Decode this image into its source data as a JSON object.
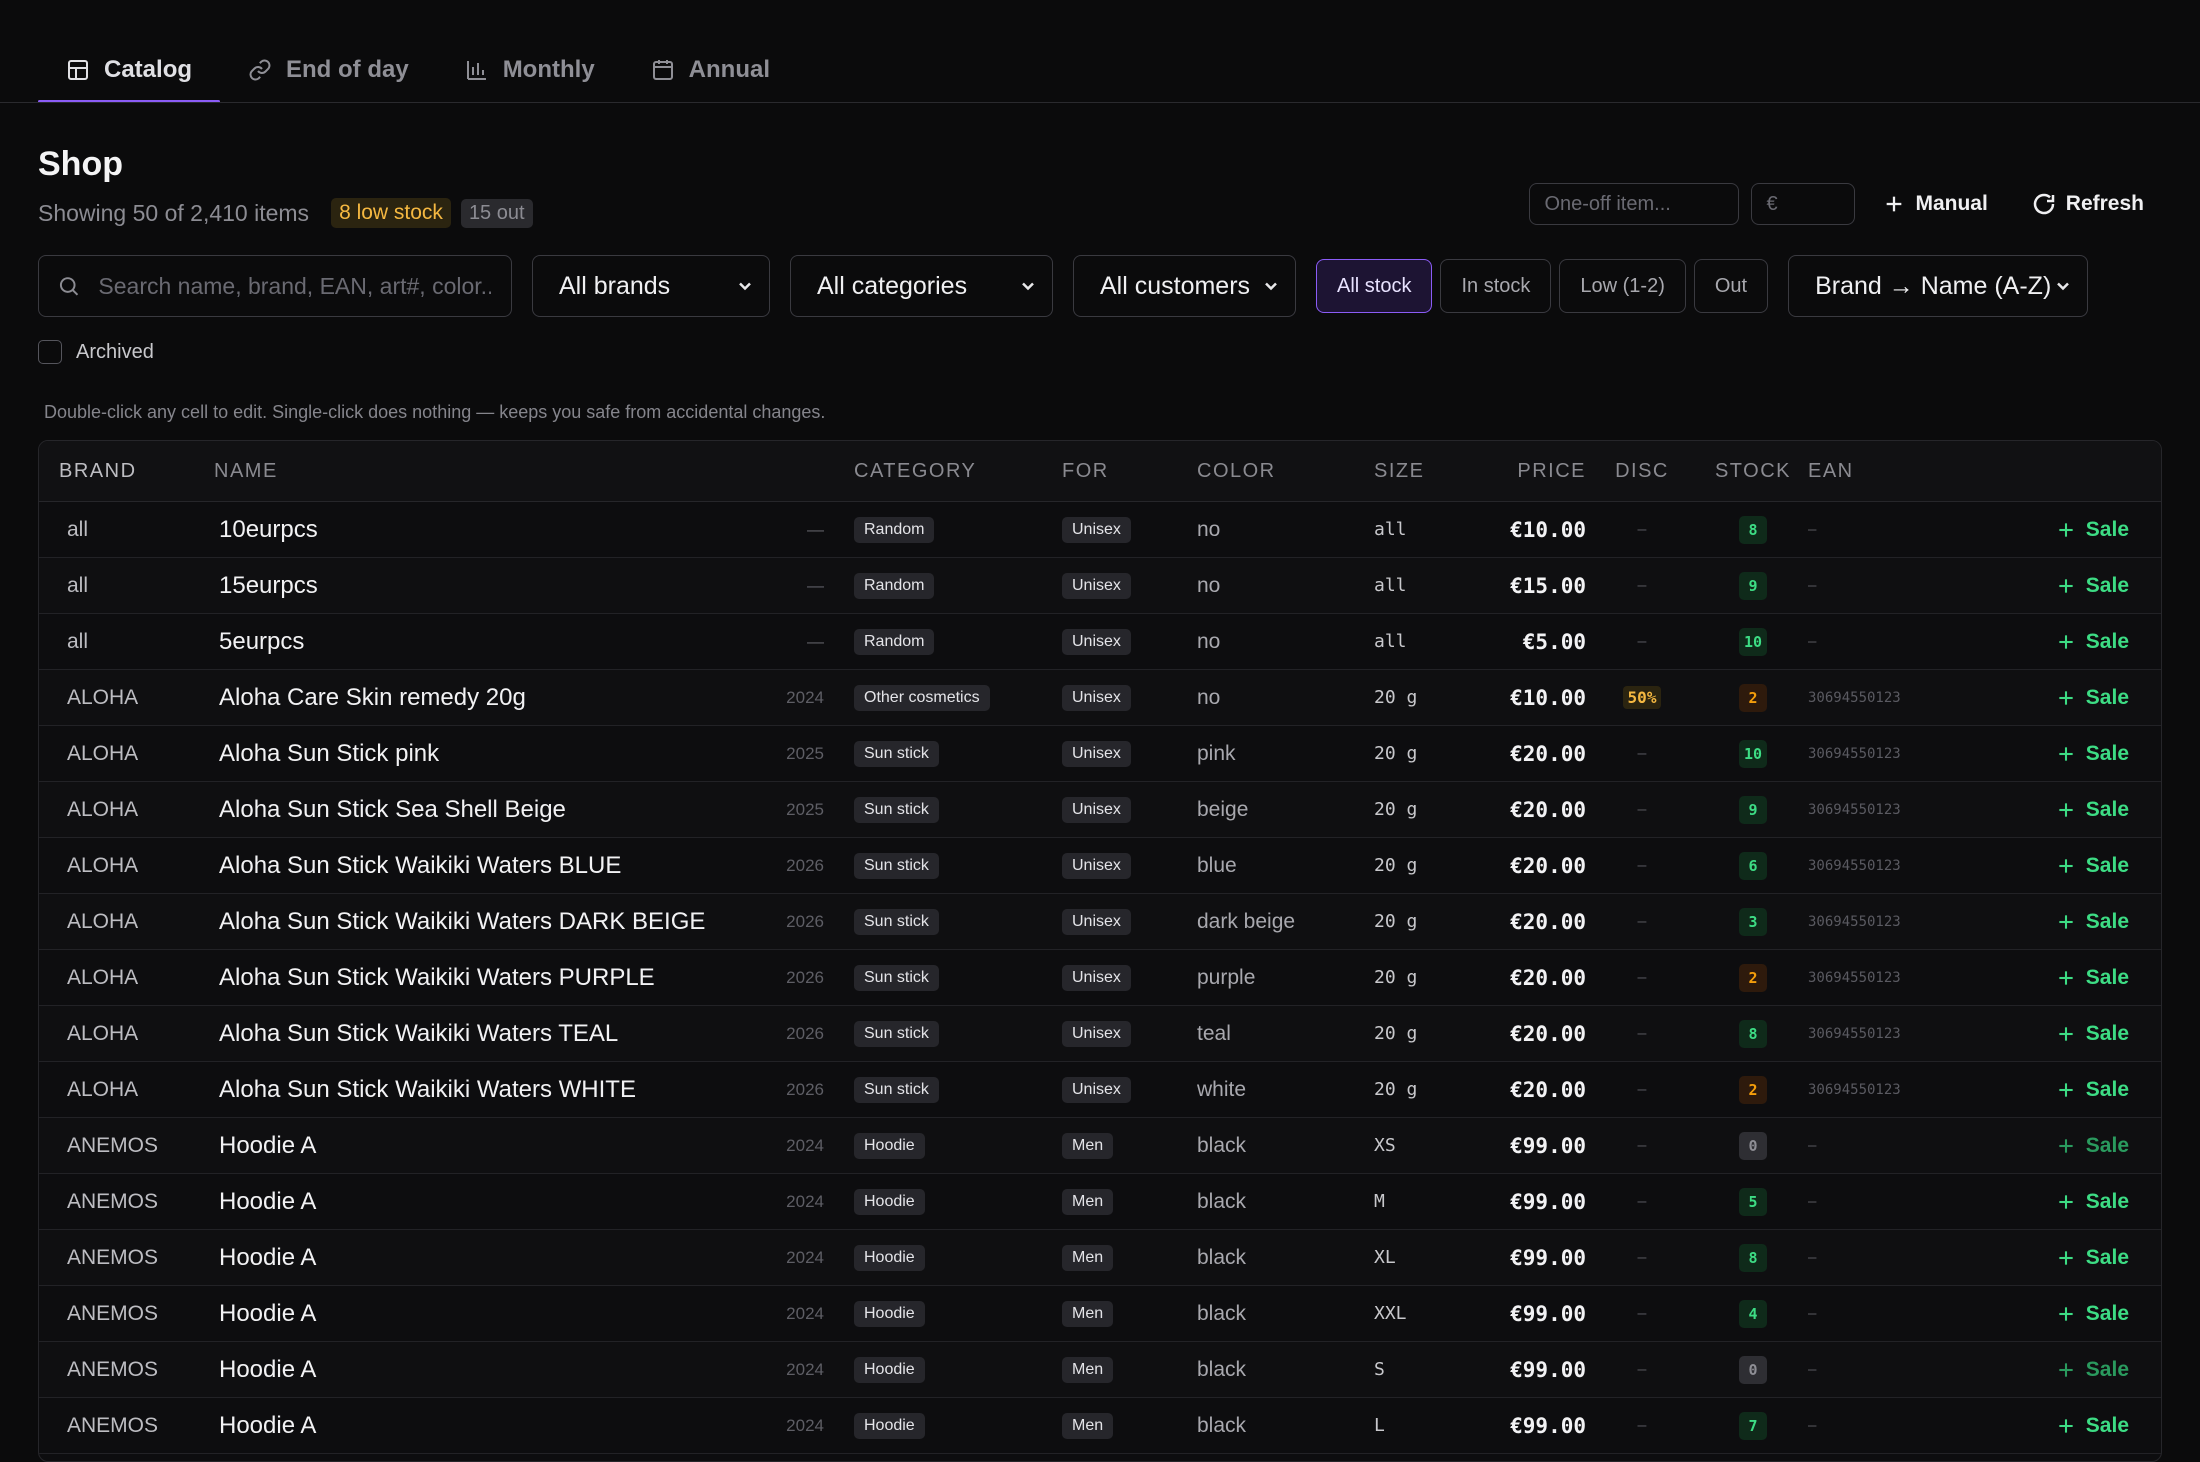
{
  "tabs": [
    {
      "label": "Catalog",
      "icon": "grid-icon",
      "active": true
    },
    {
      "label": "End of day",
      "icon": "link-icon",
      "active": false
    },
    {
      "label": "Monthly",
      "icon": "bar-chart-icon",
      "active": false
    },
    {
      "label": "Annual",
      "icon": "calendar-icon",
      "active": false
    }
  ],
  "page": {
    "title": "Shop",
    "summary": "Showing 50 of 2,410 items",
    "low_badge": "8 low stock",
    "out_badge": "15 out",
    "hint": "Double-click any cell to edit. Single-click does nothing — keeps you safe from accidental changes."
  },
  "quick": {
    "item_placeholder": "One-off item...",
    "price_placeholder": "€",
    "manual_label": "Manual",
    "refresh_label": "Refresh"
  },
  "filters": {
    "search_placeholder": "Search name, brand, EAN, art#, color...",
    "brand": "All brands",
    "category": "All categories",
    "customer": "All customers",
    "stock_chips": [
      {
        "label": "All stock",
        "active": true
      },
      {
        "label": "In stock",
        "active": false
      },
      {
        "label": "Low (1-2)",
        "active": false
      },
      {
        "label": "Out",
        "active": false
      }
    ],
    "sort": "Brand → Name (A-Z)",
    "archived_label": "Archived"
  },
  "table": {
    "headers": {
      "brand": "BRAND",
      "name": "NAME",
      "category": "CATEGORY",
      "for": "FOR",
      "color": "COLOR",
      "size": "SIZE",
      "price": "PRICE",
      "disc": "DISC",
      "stock": "STOCK",
      "ean": "EAN"
    },
    "action_label": "Sale",
    "rows": [
      {
        "brand": "all",
        "name": "10eurpcs",
        "year": "—",
        "category": "Random",
        "for": "Unisex",
        "color": "no",
        "size": "all",
        "price": "€10.00",
        "disc": "–",
        "stock": "8",
        "stock_level": "ok",
        "ean": "–"
      },
      {
        "brand": "all",
        "name": "15eurpcs",
        "year": "—",
        "category": "Random",
        "for": "Unisex",
        "color": "no",
        "size": "all",
        "price": "€15.00",
        "disc": "–",
        "stock": "9",
        "stock_level": "ok",
        "ean": "–"
      },
      {
        "brand": "all",
        "name": "5eurpcs",
        "year": "—",
        "category": "Random",
        "for": "Unisex",
        "color": "no",
        "size": "all",
        "price": "€5.00",
        "disc": "–",
        "stock": "10",
        "stock_level": "ok",
        "ean": "–"
      },
      {
        "brand": "ALOHA",
        "name": "Aloha Care Skin remedy  20g",
        "year": "2024",
        "category": "Other cosmetics",
        "for": "Unisex",
        "color": "no",
        "size": "20 g",
        "price": "€10.00",
        "disc": "50%",
        "stock": "2",
        "stock_level": "low",
        "ean": "30694550123"
      },
      {
        "brand": "ALOHA",
        "name": "Aloha Sun Stick pink",
        "year": "2025",
        "category": "Sun stick",
        "for": "Unisex",
        "color": "pink",
        "size": "20 g",
        "price": "€20.00",
        "disc": "–",
        "stock": "10",
        "stock_level": "ok",
        "ean": "30694550123"
      },
      {
        "brand": "ALOHA",
        "name": "Aloha Sun Stick Sea Shell Beige",
        "year": "2025",
        "category": "Sun stick",
        "for": "Unisex",
        "color": "beige",
        "size": "20 g",
        "price": "€20.00",
        "disc": "–",
        "stock": "9",
        "stock_level": "ok",
        "ean": "30694550123"
      },
      {
        "brand": "ALOHA",
        "name": "Aloha Sun Stick Waikiki Waters BLUE",
        "year": "2026",
        "category": "Sun stick",
        "for": "Unisex",
        "color": "blue",
        "size": "20 g",
        "price": "€20.00",
        "disc": "–",
        "stock": "6",
        "stock_level": "ok",
        "ean": "30694550123"
      },
      {
        "brand": "ALOHA",
        "name": "Aloha Sun Stick Waikiki Waters DARK BEIGE",
        "year": "2026",
        "category": "Sun stick",
        "for": "Unisex",
        "color": "dark beige",
        "size": "20 g",
        "price": "€20.00",
        "disc": "–",
        "stock": "3",
        "stock_level": "ok",
        "ean": "30694550123"
      },
      {
        "brand": "ALOHA",
        "name": "Aloha Sun Stick Waikiki Waters PURPLE",
        "year": "2026",
        "category": "Sun stick",
        "for": "Unisex",
        "color": "purple",
        "size": "20 g",
        "price": "€20.00",
        "disc": "–",
        "stock": "2",
        "stock_level": "low",
        "ean": "30694550123"
      },
      {
        "brand": "ALOHA",
        "name": "Aloha Sun Stick Waikiki Waters TEAL",
        "year": "2026",
        "category": "Sun stick",
        "for": "Unisex",
        "color": "teal",
        "size": "20 g",
        "price": "€20.00",
        "disc": "–",
        "stock": "8",
        "stock_level": "ok",
        "ean": "30694550123"
      },
      {
        "brand": "ALOHA",
        "name": "Aloha Sun Stick Waikiki Waters WHITE",
        "year": "2026",
        "category": "Sun stick",
        "for": "Unisex",
        "color": "white",
        "size": "20 g",
        "price": "€20.00",
        "disc": "–",
        "stock": "2",
        "stock_level": "low",
        "ean": "30694550123"
      },
      {
        "brand": "ANEMOS",
        "name": "Hoodie A",
        "year": "2024",
        "category": "Hoodie",
        "for": "Men",
        "color": "black",
        "size": "XS",
        "price": "€99.00",
        "disc": "–",
        "stock": "0",
        "stock_level": "zero",
        "ean": "–"
      },
      {
        "brand": "ANEMOS",
        "name": "Hoodie A",
        "year": "2024",
        "category": "Hoodie",
        "for": "Men",
        "color": "black",
        "size": "M",
        "price": "€99.00",
        "disc": "–",
        "stock": "5",
        "stock_level": "ok",
        "ean": "–"
      },
      {
        "brand": "ANEMOS",
        "name": "Hoodie A",
        "year": "2024",
        "category": "Hoodie",
        "for": "Men",
        "color": "black",
        "size": "XL",
        "price": "€99.00",
        "disc": "–",
        "stock": "8",
        "stock_level": "ok",
        "ean": "–"
      },
      {
        "brand": "ANEMOS",
        "name": "Hoodie A",
        "year": "2024",
        "category": "Hoodie",
        "for": "Men",
        "color": "black",
        "size": "XXL",
        "price": "€99.00",
        "disc": "–",
        "stock": "4",
        "stock_level": "ok",
        "ean": "–"
      },
      {
        "brand": "ANEMOS",
        "name": "Hoodie A",
        "year": "2024",
        "category": "Hoodie",
        "for": "Men",
        "color": "black",
        "size": "S",
        "price": "€99.00",
        "disc": "–",
        "stock": "0",
        "stock_level": "zero",
        "ean": "–"
      },
      {
        "brand": "ANEMOS",
        "name": "Hoodie A",
        "year": "2024",
        "category": "Hoodie",
        "for": "Men",
        "color": "black",
        "size": "L",
        "price": "€99.00",
        "disc": "–",
        "stock": "7",
        "stock_level": "ok",
        "ean": "–"
      }
    ]
  },
  "colors": {
    "accent": "#8b5cf6",
    "success": "#3ddc84",
    "warning": "#f59e0b",
    "background": "#0b0b0c"
  }
}
